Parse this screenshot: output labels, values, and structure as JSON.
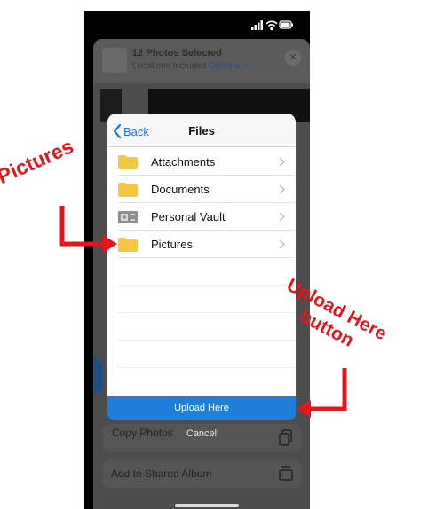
{
  "status_bar": {
    "signal_icon": "cellular-signal-icon",
    "wifi_icon": "wifi-icon",
    "battery_icon": "battery-icon"
  },
  "share_sheet": {
    "title": "12 Photos Selected",
    "subtitle": "Locations Included",
    "options_link": "Options >",
    "copy_photos": "Copy Photos",
    "add_shared_album": "Add to Shared Album"
  },
  "files_modal": {
    "back_label": "Back",
    "title": "Files",
    "items": [
      {
        "label": "Attachments",
        "icon": "folder-icon"
      },
      {
        "label": "Documents",
        "icon": "folder-icon"
      },
      {
        "label": "Personal Vault",
        "icon": "vault-icon"
      },
      {
        "label": "Pictures",
        "icon": "folder-icon"
      }
    ],
    "upload_button": "Upload Here",
    "cancel_button": "Cancel"
  },
  "annotations": {
    "pictures": "Pictures",
    "upload_line1": "Upload Here",
    "upload_line2": "button"
  },
  "colors": {
    "accent_blue": "#1e7fd8",
    "folder_yellow": "#f6c744",
    "annotation_red": "#e8141a"
  }
}
